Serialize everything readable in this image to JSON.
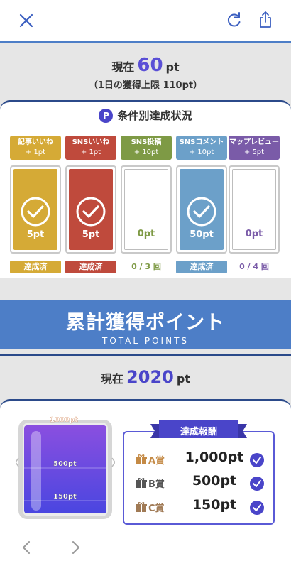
{
  "daily": {
    "now_prefix": "現在",
    "now_value": "60",
    "now_unit": "pt",
    "limit_text": "（1日の獲得上限 110pt）"
  },
  "conditions": {
    "title": "条件別達成状況",
    "p_icon": "P",
    "columns": [
      {
        "label": "記事いいね",
        "bonus": "+ 1pt",
        "points": "5pt",
        "status": "達成済",
        "achieved": true,
        "color": "#d5aa36"
      },
      {
        "label": "SNSいいね",
        "bonus": "+ 1pt",
        "points": "5pt",
        "status": "達成済",
        "achieved": true,
        "color": "#bf4a3c"
      },
      {
        "label": "SNS投稿",
        "bonus": "+ 10pt",
        "points": "0pt",
        "status": "0 / 3 回",
        "achieved": false,
        "color": "#7e9a45"
      },
      {
        "label": "SNSコメント",
        "bonus": "+ 10pt",
        "points": "50pt",
        "status": "達成済",
        "achieved": true,
        "color": "#6ca0c9"
      },
      {
        "label": "マップレビュー",
        "bonus": "+ 5pt",
        "points": "0pt",
        "status": "0 / 4 回",
        "achieved": false,
        "color": "#7a5ba8"
      }
    ]
  },
  "banner": {
    "title": "累計獲得ポイント",
    "subtitle": "TOTAL POINTS"
  },
  "total": {
    "now_prefix": "現在",
    "now_value": "2020",
    "now_unit": "pt"
  },
  "tank": {
    "marks": [
      "1000pt",
      "500pt",
      "150pt"
    ],
    "fill_fraction": 1.0
  },
  "rewards": {
    "title": "達成報酬",
    "items": [
      {
        "rank": "A賞",
        "points": "1,000pt",
        "color": "#c48a45"
      },
      {
        "rank": "B賞",
        "points": "500pt",
        "color": "#555555"
      },
      {
        "rank": "C賞",
        "points": "150pt",
        "color": "#a07a55"
      }
    ]
  },
  "icons": {
    "close": "close-icon",
    "reload": "reload-icon",
    "share": "share-icon",
    "prev": "chevron-left-icon",
    "next": "chevron-right-icon"
  },
  "colors": {
    "accent": "#4a45c9",
    "banner": "#4d7ec7",
    "navy": "#2b4a8a"
  }
}
